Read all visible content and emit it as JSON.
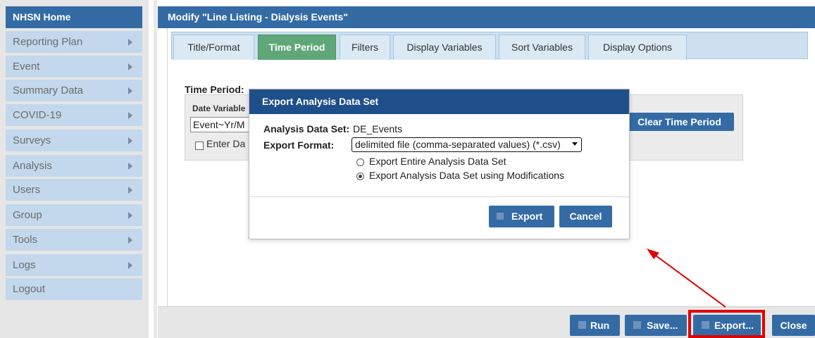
{
  "sidebar": {
    "home": "NHSN Home",
    "items": [
      {
        "label": "Reporting Plan",
        "has_submenu": true
      },
      {
        "label": "Event",
        "has_submenu": true
      },
      {
        "label": "Summary Data",
        "has_submenu": true
      },
      {
        "label": "COVID-19",
        "has_submenu": true
      },
      {
        "label": "Surveys",
        "has_submenu": true
      },
      {
        "label": "Analysis",
        "has_submenu": true
      },
      {
        "label": "Users",
        "has_submenu": true
      },
      {
        "label": "Group",
        "has_submenu": true
      },
      {
        "label": "Tools",
        "has_submenu": true
      },
      {
        "label": "Logs",
        "has_submenu": true
      },
      {
        "label": "Logout",
        "has_submenu": false
      }
    ]
  },
  "main": {
    "title": "Modify \"Line Listing - Dialysis Events\"",
    "tabs": [
      {
        "label": "Title/Format",
        "active": false
      },
      {
        "label": "Time Period",
        "active": true
      },
      {
        "label": "Filters",
        "active": false
      },
      {
        "label": "Display Variables",
        "active": false
      },
      {
        "label": "Sort Variables",
        "active": false
      },
      {
        "label": "Display Options",
        "active": false
      }
    ],
    "time_period": {
      "label": "Time Period:",
      "date_variable_label": "Date Variable",
      "date_variable_value": "Event~Yr/M",
      "enter_date_label": "Enter Da",
      "clear_button": "Clear Time Period"
    }
  },
  "bottom_bar": {
    "run": "Run",
    "save": "Save...",
    "export": "Export...",
    "close": "Close"
  },
  "modal": {
    "title": "Export Analysis Data Set",
    "dataset_label": "Analysis Data Set:",
    "dataset_value": "DE_Events",
    "format_label": "Export Format:",
    "format_value": "delimited file (comma-separated values) (*.csv)",
    "options": [
      {
        "label": "Export Entire Analysis Data Set",
        "selected": false
      },
      {
        "label": "Export Analysis Data Set using Modifications",
        "selected": true
      }
    ],
    "export_button": "Export",
    "cancel_button": "Cancel"
  },
  "colors": {
    "brand_blue": "#346ba5",
    "modal_header": "#1f4f8a",
    "active_tab": "#5fa779",
    "annotation_red": "#e20000"
  }
}
